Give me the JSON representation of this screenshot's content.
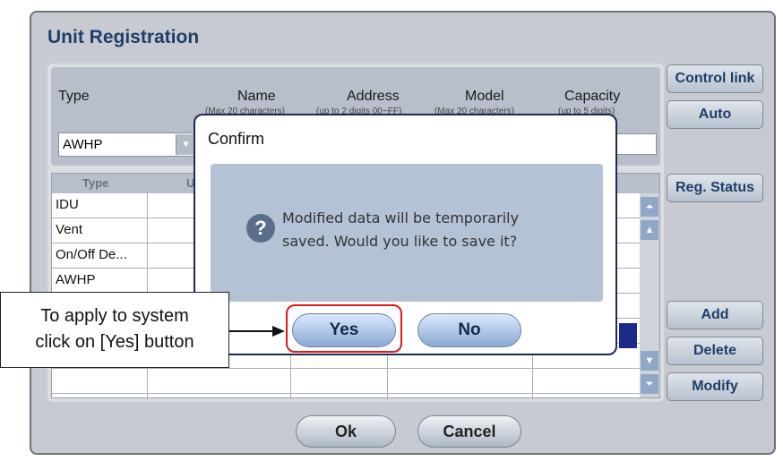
{
  "window": {
    "title": "Unit Registration"
  },
  "form": {
    "headers": {
      "type": "Type",
      "name": "Name",
      "name_hint": "(Max 20 characters)",
      "address": "Address",
      "address_hint": "(up to 2 digits 00~FF)",
      "model": "Model",
      "model_hint": "(Max 20 characters)",
      "capacity": "Capacity",
      "capacity_hint": "(up to 5 digits)"
    },
    "type_value": "AWHP"
  },
  "list": {
    "column_type": "Type",
    "column_u": "U",
    "rows": [
      "IDU",
      "Vent",
      "On/Off De...",
      "AWHP",
      "",
      "",
      "",
      ""
    ]
  },
  "side_buttons": {
    "control_link": "Control link",
    "auto": "Auto",
    "reg_status": "Reg. Status",
    "add": "Add",
    "delete": "Delete",
    "modify": "Modify"
  },
  "footer": {
    "ok": "Ok",
    "cancel": "Cancel"
  },
  "dialog": {
    "title": "Confirm",
    "message_line1": "Modified data will be temporarily",
    "message_line2": "saved.  Would you like to save it?",
    "yes": "Yes",
    "no": "No"
  },
  "callout": {
    "line1": "To apply to system",
    "line2": "click on [Yes] button"
  },
  "colors": {
    "highlight": "#e01818",
    "title_blue": "#1f3f6a"
  }
}
